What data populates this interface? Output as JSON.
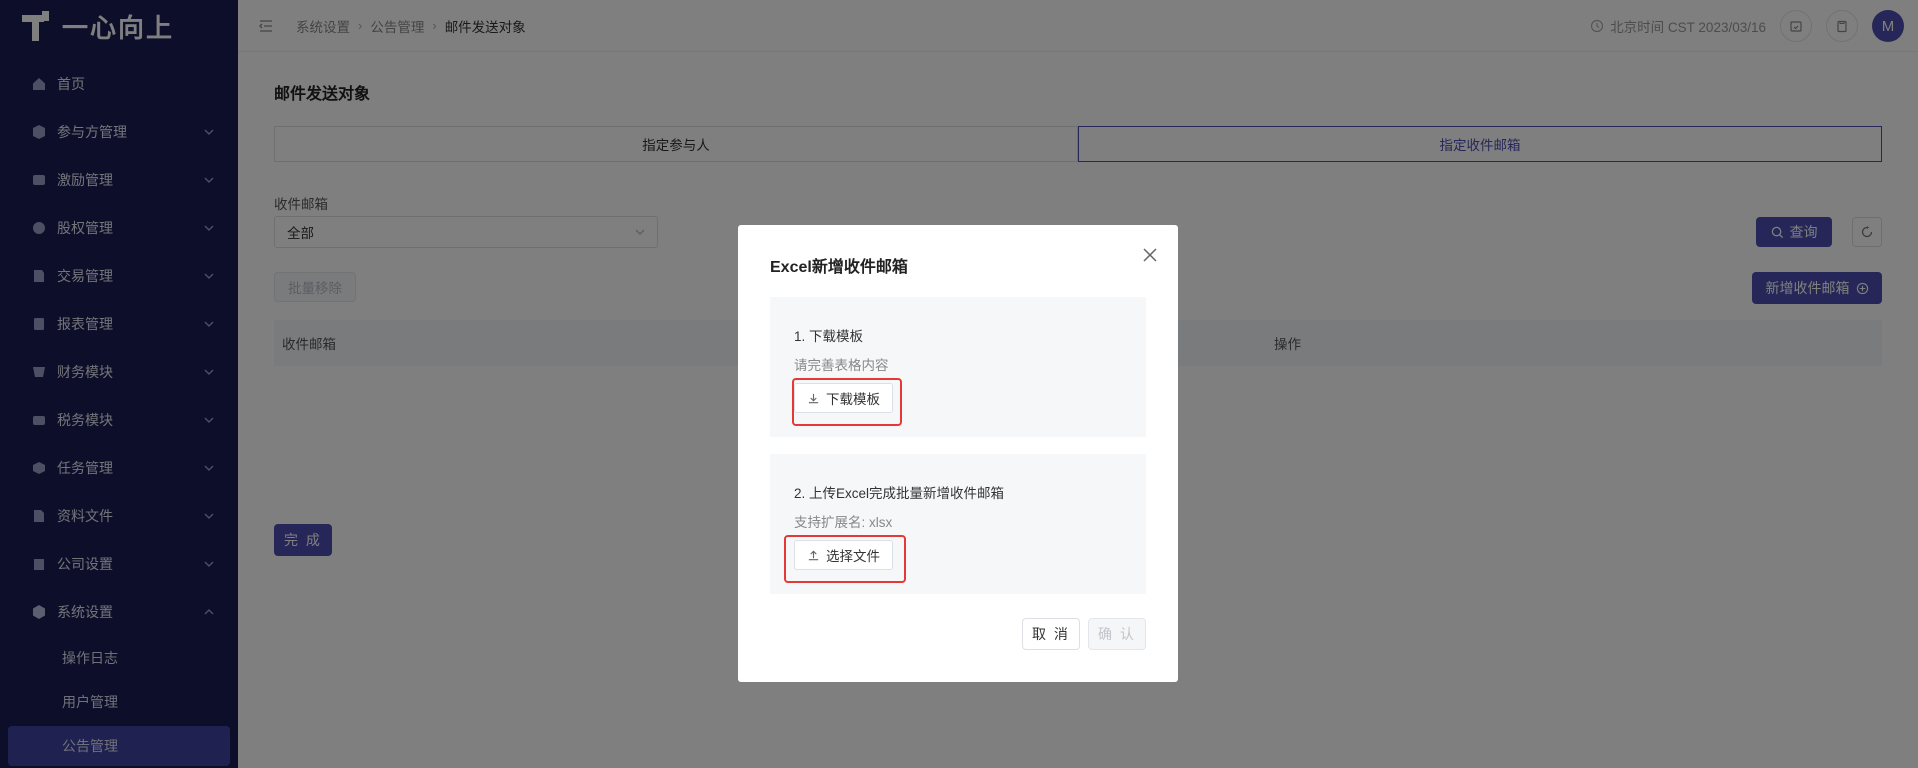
{
  "app": {
    "logo_text": "一心向上"
  },
  "colors": {
    "sidebar_bg": "#1a1e55",
    "accent": "#4c4fb0",
    "highlight": "#e53935"
  },
  "sidebar": {
    "items": [
      {
        "label": "首页",
        "icon": "home-icon",
        "expandable": false
      },
      {
        "label": "参与方管理",
        "icon": "participant-icon",
        "expandable": true
      },
      {
        "label": "激励管理",
        "icon": "incentive-icon",
        "expandable": true
      },
      {
        "label": "股权管理",
        "icon": "equity-icon",
        "expandable": true
      },
      {
        "label": "交易管理",
        "icon": "trade-icon",
        "expandable": true
      },
      {
        "label": "报表管理",
        "icon": "report-icon",
        "expandable": true
      },
      {
        "label": "财务模块",
        "icon": "finance-icon",
        "expandable": true
      },
      {
        "label": "税务模块",
        "icon": "tax-icon",
        "expandable": true
      },
      {
        "label": "任务管理",
        "icon": "task-icon",
        "expandable": true
      },
      {
        "label": "资料文件",
        "icon": "file-icon",
        "expandable": true
      },
      {
        "label": "公司设置",
        "icon": "company-icon",
        "expandable": true
      },
      {
        "label": "系统设置",
        "icon": "settings-icon",
        "expandable": true,
        "expanded": true
      }
    ],
    "subitems": [
      {
        "label": "操作日志"
      },
      {
        "label": "用户管理"
      },
      {
        "label": "公告管理",
        "active": true
      }
    ]
  },
  "header": {
    "breadcrumb": [
      "系统设置",
      "公告管理",
      "邮件发送对象"
    ],
    "clock_text": "北京时间 CST 2023/03/16",
    "avatar_letter": "M"
  },
  "main": {
    "title": "邮件发送对象",
    "tabs": [
      {
        "label": "指定参与人",
        "active": false
      },
      {
        "label": "指定收件邮箱",
        "active": true
      }
    ],
    "filter_label": "收件邮箱",
    "filter_value": "全部",
    "query_label": "查询",
    "batch_remove_label": "批量移除",
    "add_label": "新增收件邮箱",
    "table_headers": [
      "收件邮箱",
      "操作"
    ],
    "done_label": "完 成"
  },
  "dialog": {
    "title": "Excel新增收件邮箱",
    "step1": {
      "title": "1. 下载模板",
      "hint": "请完善表格内容",
      "button": "下载模板"
    },
    "step2": {
      "title": "2. 上传Excel完成批量新增收件邮箱",
      "hint": "支持扩展名: xlsx",
      "button": "选择文件"
    },
    "cancel_label": "取 消",
    "confirm_label": "确 认"
  }
}
